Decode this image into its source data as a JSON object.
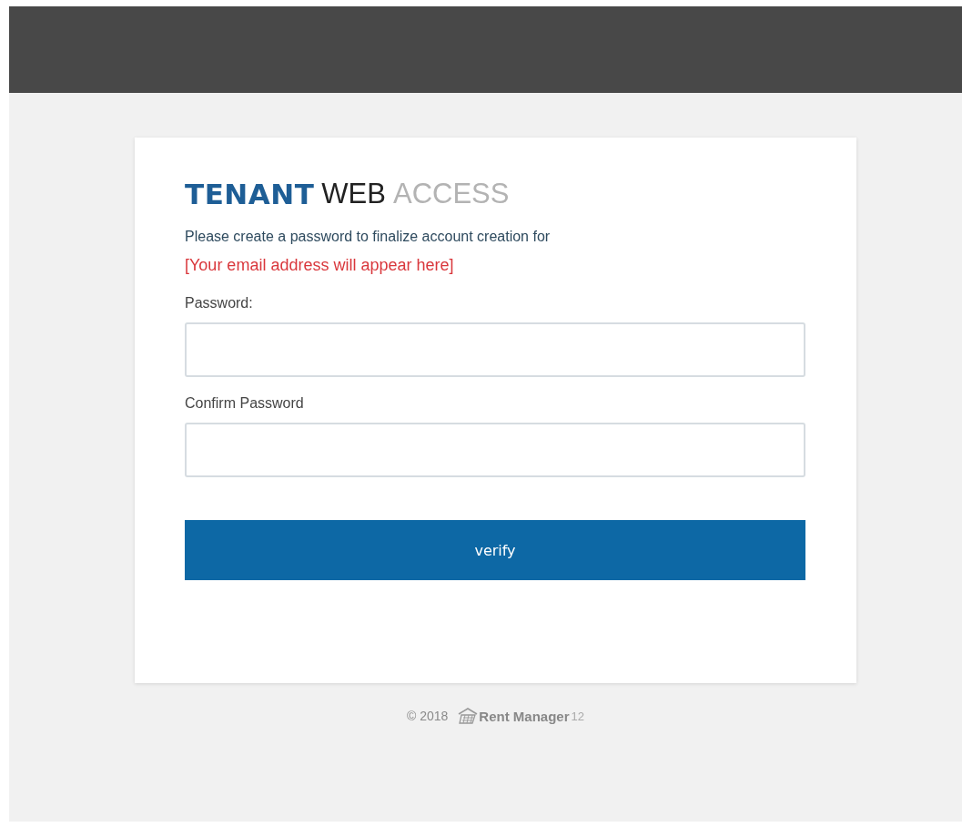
{
  "logo": {
    "parts": [
      {
        "text": "TENANT",
        "kind": "strong"
      },
      {
        "text": "WEB",
        "kind": "dark"
      },
      {
        "text": "ACCESS",
        "kind": "light"
      }
    ]
  },
  "message": "Please create a password to finalize account creation for",
  "email_notice": "[Your email address will appear here]",
  "fields": [
    {
      "label": "Password:"
    },
    {
      "label": "Confirm Password"
    }
  ],
  "submit_button": "verify",
  "footer": {
    "copyright": "© 2018",
    "brand": "Rent Manager",
    "version": "12"
  }
}
